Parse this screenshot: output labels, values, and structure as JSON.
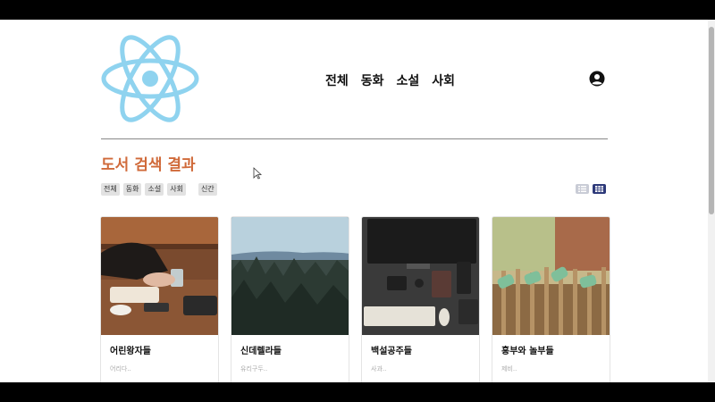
{
  "header": {
    "logo_icon": "react-atom-logo",
    "nav": [
      "전체",
      "동화",
      "소설",
      "사회"
    ],
    "user_icon": "user-circle-icon"
  },
  "results": {
    "title": "도서 검색 결과",
    "filters": [
      "전체",
      "동화",
      "소설",
      "사회"
    ],
    "extra_filter": "신간",
    "view_modes": [
      "list-view-icon",
      "grid-view-icon"
    ],
    "active_view": "grid"
  },
  "books": [
    {
      "title": "어린왕자들",
      "author": "어리다..",
      "publisher": "..."
    },
    {
      "title": "신데렐라들",
      "author": "유리구두..",
      "publisher": "..."
    },
    {
      "title": "백설공주들",
      "author": "사과..",
      "publisher": "..."
    },
    {
      "title": "흥부와 놀부들",
      "author": "제비..",
      "publisher": "..."
    }
  ],
  "colors": {
    "accent": "#d06a3a",
    "logo": "#8fd3ef",
    "grid_active": "#2e3a7a"
  }
}
